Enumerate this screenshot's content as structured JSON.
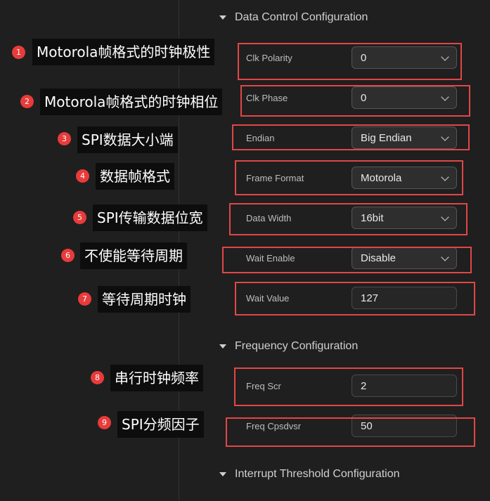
{
  "sections": {
    "data_control": "Data Control Configuration",
    "frequency": "Frequency Configuration",
    "interrupt": "Interrupt Threshold Configuration"
  },
  "fields": [
    {
      "label": "Clk Polarity",
      "value": "0",
      "type": "select"
    },
    {
      "label": "Clk Phase",
      "value": "0",
      "type": "select"
    },
    {
      "label": "Endian",
      "value": "Big Endian",
      "type": "select"
    },
    {
      "label": "Frame Format",
      "value": "Motorola",
      "type": "select"
    },
    {
      "label": "Data Width",
      "value": "16bit",
      "type": "select"
    },
    {
      "label": "Wait Enable",
      "value": "Disable",
      "type": "select"
    },
    {
      "label": "Wait Value",
      "value": "127",
      "type": "input"
    },
    {
      "label": "Freq Scr",
      "value": "2",
      "type": "input"
    },
    {
      "label": "Freq Cpsdvsr",
      "value": "50",
      "type": "input"
    }
  ],
  "annotations": [
    {
      "num": "1",
      "text": "Motorola帧格式的时钟极性"
    },
    {
      "num": "2",
      "text": "Motorola帧格式的时钟相位"
    },
    {
      "num": "3",
      "text": "SPI数据大小端"
    },
    {
      "num": "4",
      "text": "数据帧格式"
    },
    {
      "num": "5",
      "text": "SPI传输数据位宽"
    },
    {
      "num": "6",
      "text": "不使能等待周期"
    },
    {
      "num": "7",
      "text": "等待周期时钟"
    },
    {
      "num": "8",
      "text": "串行时钟频率"
    },
    {
      "num": "9",
      "text": "SPI分频因子"
    }
  ],
  "colors": {
    "background": "#1f1f1f",
    "annotation_red": "#e24646",
    "badge_red": "#e83b3b"
  }
}
